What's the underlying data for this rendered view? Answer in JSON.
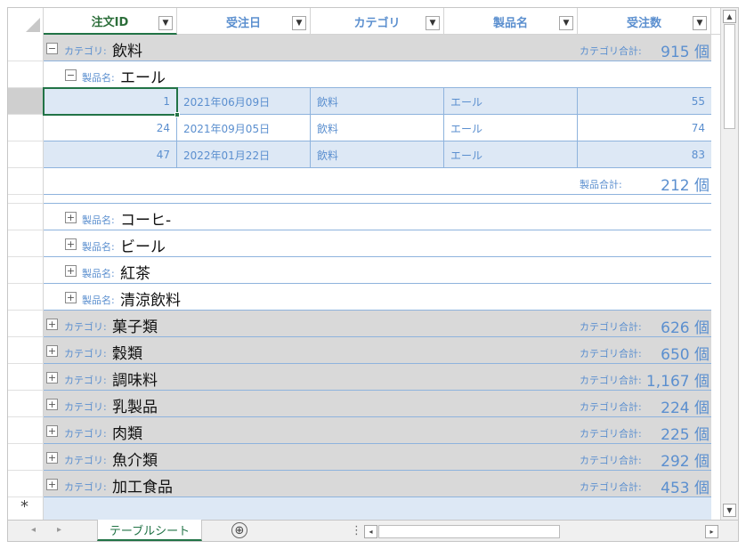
{
  "columns": [
    {
      "label": "注文ID",
      "active": true
    },
    {
      "label": "受注日",
      "active": false
    },
    {
      "label": "カテゴリ",
      "active": false
    },
    {
      "label": "製品名",
      "active": false
    },
    {
      "label": "受注数",
      "active": false
    }
  ],
  "dropdown_glyph": "▼",
  "expanded_category": {
    "prefix": "カテゴリ:",
    "name": "飲料",
    "sum_label": "カテゴリ合計:",
    "sum_value": "915 個"
  },
  "expanded_product": {
    "prefix": "製品名:",
    "name": "エール",
    "rows": [
      {
        "id": "1",
        "date": "2021年06月09日",
        "category": "飲料",
        "product": "エール",
        "qty": "55"
      },
      {
        "id": "24",
        "date": "2021年09月05日",
        "category": "飲料",
        "product": "エール",
        "qty": "74"
      },
      {
        "id": "47",
        "date": "2022年01月22日",
        "category": "飲料",
        "product": "エール",
        "qty": "83"
      }
    ],
    "sum_label": "製品合計:",
    "sum_value": "212 個"
  },
  "collapsed_products": [
    {
      "prefix": "製品名:",
      "name": "コーヒ-"
    },
    {
      "prefix": "製品名:",
      "name": "ビール"
    },
    {
      "prefix": "製品名:",
      "name": "紅茶"
    },
    {
      "prefix": "製品名:",
      "name": "清涼飲料"
    }
  ],
  "collapsed_categories": [
    {
      "prefix": "カテゴリ:",
      "name": "菓子類",
      "sum_label": "カテゴリ合計:",
      "sum_value": "626 個"
    },
    {
      "prefix": "カテゴリ:",
      "name": "穀類",
      "sum_label": "カテゴリ合計:",
      "sum_value": "650 個"
    },
    {
      "prefix": "カテゴリ:",
      "name": "調味料",
      "sum_label": "カテゴリ合計:",
      "sum_value": "1,167 個"
    },
    {
      "prefix": "カテゴリ:",
      "name": "乳製品",
      "sum_label": "カテゴリ合計:",
      "sum_value": "224 個"
    },
    {
      "prefix": "カテゴリ:",
      "name": "肉類",
      "sum_label": "カテゴリ合計:",
      "sum_value": "225 個"
    },
    {
      "prefix": "カテゴリ:",
      "name": "魚介類",
      "sum_label": "カテゴリ合計:",
      "sum_value": "292 個"
    },
    {
      "prefix": "カテゴリ:",
      "name": "加工食品",
      "sum_label": "カテゴリ合計:",
      "sum_value": "453 個"
    }
  ],
  "new_record_glyph": "*",
  "expand_glyph": "+",
  "collapse_glyph": "−",
  "footer": {
    "sheet_tab": "テーブルシート",
    "add_sheet_glyph": "⊕",
    "split_glyph": "⋮"
  },
  "colors": {
    "accent": "#217346",
    "label_blue": "#5b8fcf",
    "category_bg": "#d9d9d9",
    "row_bg": "#dde8f5"
  }
}
